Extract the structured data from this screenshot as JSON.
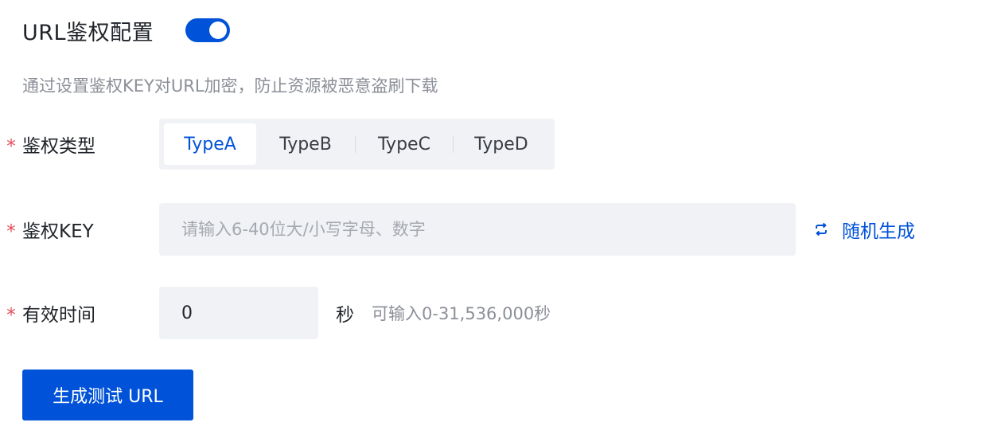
{
  "header": {
    "title": "URL鉴权配置",
    "toggle_on": true
  },
  "description": "通过设置鉴权KEY对URL加密，防止资源被恶意盗刷下载",
  "auth_type": {
    "label": "鉴权类型",
    "required_mark": "*",
    "options": [
      {
        "label": "TypeA",
        "selected": true
      },
      {
        "label": "TypeB",
        "selected": false
      },
      {
        "label": "TypeC",
        "selected": false
      },
      {
        "label": "TypeD",
        "selected": false
      }
    ]
  },
  "auth_key": {
    "label": "鉴权KEY",
    "required_mark": "*",
    "value": "",
    "placeholder": "请输入6-40位大/小写字母、数字",
    "random_label": "随机生成",
    "random_icon": "refresh-icon"
  },
  "valid_time": {
    "label": "有效时间",
    "required_mark": "*",
    "value": "0",
    "unit": "秒",
    "hint": "可输入0-31,536,000秒"
  },
  "generate_button": {
    "label": "生成测试 URL"
  },
  "colors": {
    "primary": "#0052d9",
    "required": "#e34d59",
    "field_bg": "#f1f2f5",
    "muted_text": "#8b8f97"
  }
}
